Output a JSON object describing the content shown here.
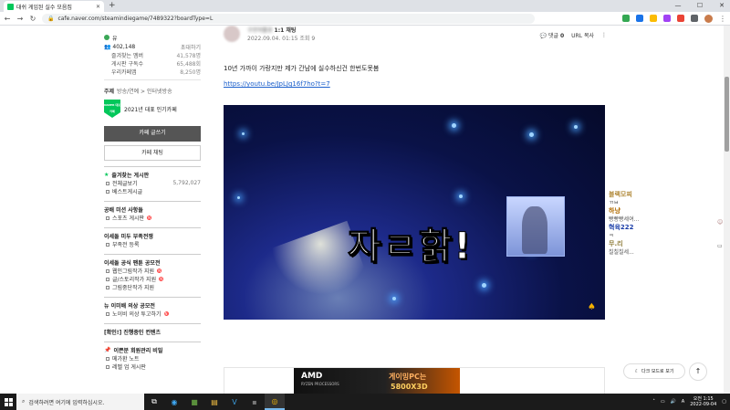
{
  "browser": {
    "tab_title": "대쉬 게임된 실수 모음집",
    "tab_close": "✕",
    "new_tab": "+",
    "address": "cafe.naver.com/steamindiegame/7489322?boardType=L",
    "window_buttons": [
      "—",
      "☐",
      "✕"
    ]
  },
  "sidebar": {
    "cafe_level": "유",
    "member_count": "402,148",
    "member_label": "초대하기",
    "stats": [
      {
        "label": "즐겨찾는 멤버",
        "value": "41,578명"
      },
      {
        "label": "게시판 구독수",
        "value": "65,488회"
      },
      {
        "label": "우리카페앱",
        "value": "8,250명"
      }
    ],
    "topic_key": "주제",
    "topic_value": "방송/연예 > 인터넷방송",
    "naver_badge_text": "NAVER 대표카페",
    "naver_badge_label": "2021년 대표 인기카페",
    "write_button": "카페 글쓰기",
    "chat_button": "카페 채팅",
    "favorites_head": "즐겨찾는 게시판",
    "favorites": [
      {
        "label": "전체글보기",
        "count": "5,792,027"
      },
      {
        "label": "베스트게시글",
        "count": ""
      }
    ],
    "sections": [
      {
        "head": "공배 미션 사항들",
        "items": [
          {
            "label": "스포츠 게시판",
            "new": true
          }
        ]
      },
      {
        "head": "이세돌 미두 부족전쟁",
        "items": [
          {
            "label": "부족전 등록",
            "new": false
          }
        ]
      },
      {
        "head": "이세돌 공식 팬툰 공모전",
        "items": [
          {
            "label": "웹인그림작가 지원",
            "new": true
          },
          {
            "label": "글/스토리작가 지원",
            "new": true
          },
          {
            "label": "그림중단작가 지원",
            "new": false
          }
        ]
      },
      {
        "head": "뉴 이미배 의상 공모전",
        "items": [
          {
            "label": "노이비 의상 투고하기",
            "new": true
          }
        ]
      },
      {
        "head": "[확인!] 진행중인 컨텐츠",
        "items": []
      },
      {
        "head": "이쁜분 회원관리 비밀",
        "items": [
          {
            "label": "메가환 노트",
            "new": false
          },
          {
            "label": "레벨 업 게시판",
            "new": false
          }
        ]
      }
    ]
  },
  "post": {
    "author_name": "구르아블로",
    "author_grade": "1:1 채팅",
    "date": "2022.09.04. 01:15",
    "views": "조회 9",
    "comments_label": "댓글",
    "comments_count": "0",
    "url_copy": "URL 복사",
    "title": "10년 가까이 가랑지만 제가 간남에 실수하신건 한번도못봄",
    "link": "https://youtu.be/JpLJg16f7ho?t=7",
    "video_caption": "자ㄹ핡!",
    "video_logo": "♠"
  },
  "ad": {
    "brand": "AMD",
    "brand_sub": "RYZEN PROCESSORS",
    "headline": "게이밍PC는",
    "product": "5800X3D"
  },
  "chat": {
    "messages": [
      {
        "user": "블랙모찌",
        "text": "ㄲㅂ",
        "color": "#b28b3c"
      },
      {
        "user": "하냥",
        "text": "빵빵빵세여...",
        "color": "#b06b00"
      },
      {
        "user": "혁육222",
        "text": "ㅋ",
        "color": "#1b3ea8"
      },
      {
        "user": "무.리",
        "text": "칠칠칠세...",
        "color": "#8f7c3a"
      }
    ]
  },
  "floating": {
    "darkmode": "다크 모드로 보기",
    "to_top": "↑"
  },
  "taskbar": {
    "search_placeholder": "검색하려면 여기에 입력하십시오.",
    "time": "오전 1:15",
    "date": "2022-09-04"
  }
}
